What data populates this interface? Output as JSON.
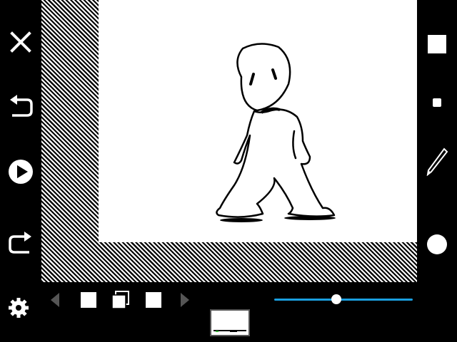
{
  "left_toolbar": {
    "tools": [
      {
        "name": "close",
        "icon": "close-icon"
      },
      {
        "name": "undo",
        "icon": "undo-icon"
      },
      {
        "name": "play",
        "icon": "play-icon"
      },
      {
        "name": "redo",
        "icon": "redo-icon"
      },
      {
        "name": "settings",
        "icon": "gear-icon"
      }
    ]
  },
  "right_toolbar": {
    "tools": [
      {
        "name": "brush-size-large",
        "icon": "square-large-icon"
      },
      {
        "name": "brush-size-small",
        "icon": "square-small-icon"
      },
      {
        "name": "pen-tool",
        "icon": "pen-icon"
      },
      {
        "name": "color",
        "icon": "color-circle-icon",
        "color": "#ffffff"
      }
    ]
  },
  "timeline": {
    "controls": [
      {
        "name": "previous-frame",
        "icon": "triangle-left-icon"
      },
      {
        "name": "add-frame",
        "icon": "square-icon"
      },
      {
        "name": "duplicate-frame",
        "icon": "copy-frame-icon"
      },
      {
        "name": "blank-frame",
        "icon": "square-icon"
      },
      {
        "name": "next-frame",
        "icon": "triangle-right-icon"
      }
    ],
    "speed_slider": {
      "value": 0.45,
      "color": "#1a9fe0"
    },
    "frames": [
      {
        "selected": true
      }
    ]
  },
  "colors": {
    "background": "#000000",
    "canvas": "#ffffff",
    "accent": "#1a9fe0"
  }
}
